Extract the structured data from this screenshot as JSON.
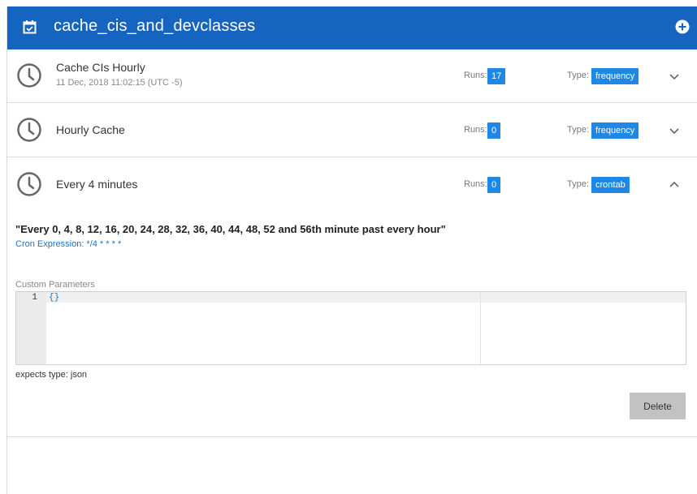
{
  "header": {
    "title": "cache_cis_and_devclasses",
    "calendar_icon": "calendar-check-icon",
    "add_icon": "plus-circle-icon",
    "bg_color": "#1565c0"
  },
  "schedules": [
    {
      "name": "Cache CIs Hourly",
      "timestamp": "11 Dec, 2018 11:02:15 (UTC -5)",
      "runs_label": "Runs:",
      "runs": "17",
      "type_label": "Type:",
      "type": "frequency",
      "expanded": false
    },
    {
      "name": "Hourly Cache",
      "runs_label": "Runs:",
      "runs": "0",
      "type_label": "Type:",
      "type": "frequency",
      "expanded": false
    },
    {
      "name": "Every 4 minutes",
      "runs_label": "Runs:",
      "runs": "0",
      "type_label": "Type:",
      "type": "crontab",
      "expanded": true
    }
  ],
  "details": {
    "description": "\"Every 0, 4, 8, 12, 16, 20, 24, 28, 32, 36, 40, 44, 48, 52 and 56th minute past every hour\"",
    "cron_expression": "Cron Expression: */4 * * * *",
    "custom_params_label": "Custom Parameters",
    "line_number": "1",
    "code": "{}",
    "expects_type": "expects type: json",
    "delete_label": "Delete"
  },
  "colors": {
    "accent": "#1f87e5",
    "link": "#1a73c8",
    "button_gray": "#c2c2c2"
  }
}
